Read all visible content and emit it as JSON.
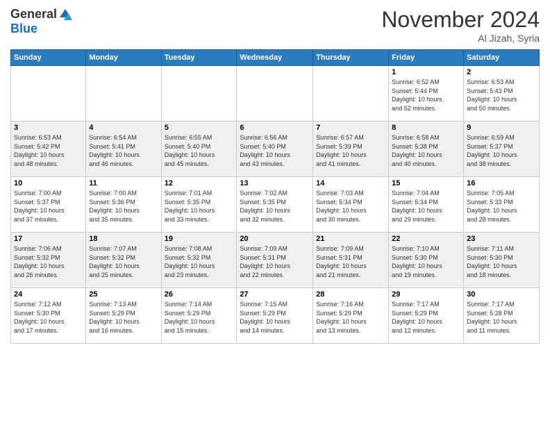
{
  "header": {
    "logo_general": "General",
    "logo_blue": "Blue",
    "month_title": "November 2024",
    "location": "Al Jizah, Syria"
  },
  "days_of_week": [
    "Sunday",
    "Monday",
    "Tuesday",
    "Wednesday",
    "Thursday",
    "Friday",
    "Saturday"
  ],
  "weeks": [
    [
      {
        "day": "",
        "info": ""
      },
      {
        "day": "",
        "info": ""
      },
      {
        "day": "",
        "info": ""
      },
      {
        "day": "",
        "info": ""
      },
      {
        "day": "",
        "info": ""
      },
      {
        "day": "1",
        "info": "Sunrise: 6:52 AM\nSunset: 5:44 PM\nDaylight: 10 hours\nand 52 minutes."
      },
      {
        "day": "2",
        "info": "Sunrise: 6:53 AM\nSunset: 5:43 PM\nDaylight: 10 hours\nand 50 minutes."
      }
    ],
    [
      {
        "day": "3",
        "info": "Sunrise: 6:53 AM\nSunset: 5:42 PM\nDaylight: 10 hours\nand 48 minutes."
      },
      {
        "day": "4",
        "info": "Sunrise: 6:54 AM\nSunset: 5:41 PM\nDaylight: 10 hours\nand 46 minutes."
      },
      {
        "day": "5",
        "info": "Sunrise: 6:55 AM\nSunset: 5:40 PM\nDaylight: 10 hours\nand 45 minutes."
      },
      {
        "day": "6",
        "info": "Sunrise: 6:56 AM\nSunset: 5:40 PM\nDaylight: 10 hours\nand 43 minutes."
      },
      {
        "day": "7",
        "info": "Sunrise: 6:57 AM\nSunset: 5:39 PM\nDaylight: 10 hours\nand 41 minutes."
      },
      {
        "day": "8",
        "info": "Sunrise: 6:58 AM\nSunset: 5:38 PM\nDaylight: 10 hours\nand 40 minutes."
      },
      {
        "day": "9",
        "info": "Sunrise: 6:59 AM\nSunset: 5:37 PM\nDaylight: 10 hours\nand 38 minutes."
      }
    ],
    [
      {
        "day": "10",
        "info": "Sunrise: 7:00 AM\nSunset: 5:37 PM\nDaylight: 10 hours\nand 37 minutes."
      },
      {
        "day": "11",
        "info": "Sunrise: 7:00 AM\nSunset: 5:36 PM\nDaylight: 10 hours\nand 35 minutes."
      },
      {
        "day": "12",
        "info": "Sunrise: 7:01 AM\nSunset: 5:35 PM\nDaylight: 10 hours\nand 33 minutes."
      },
      {
        "day": "13",
        "info": "Sunrise: 7:02 AM\nSunset: 5:35 PM\nDaylight: 10 hours\nand 32 minutes."
      },
      {
        "day": "14",
        "info": "Sunrise: 7:03 AM\nSunset: 5:34 PM\nDaylight: 10 hours\nand 30 minutes."
      },
      {
        "day": "15",
        "info": "Sunrise: 7:04 AM\nSunset: 5:34 PM\nDaylight: 10 hours\nand 29 minutes."
      },
      {
        "day": "16",
        "info": "Sunrise: 7:05 AM\nSunset: 5:33 PM\nDaylight: 10 hours\nand 28 minutes."
      }
    ],
    [
      {
        "day": "17",
        "info": "Sunrise: 7:06 AM\nSunset: 5:32 PM\nDaylight: 10 hours\nand 26 minutes."
      },
      {
        "day": "18",
        "info": "Sunrise: 7:07 AM\nSunset: 5:32 PM\nDaylight: 10 hours\nand 25 minutes."
      },
      {
        "day": "19",
        "info": "Sunrise: 7:08 AM\nSunset: 5:32 PM\nDaylight: 10 hours\nand 23 minutes."
      },
      {
        "day": "20",
        "info": "Sunrise: 7:09 AM\nSunset: 5:31 PM\nDaylight: 10 hours\nand 22 minutes."
      },
      {
        "day": "21",
        "info": "Sunrise: 7:09 AM\nSunset: 5:31 PM\nDaylight: 10 hours\nand 21 minutes."
      },
      {
        "day": "22",
        "info": "Sunrise: 7:10 AM\nSunset: 5:30 PM\nDaylight: 10 hours\nand 19 minutes."
      },
      {
        "day": "23",
        "info": "Sunrise: 7:11 AM\nSunset: 5:30 PM\nDaylight: 10 hours\nand 18 minutes."
      }
    ],
    [
      {
        "day": "24",
        "info": "Sunrise: 7:12 AM\nSunset: 5:30 PM\nDaylight: 10 hours\nand 17 minutes."
      },
      {
        "day": "25",
        "info": "Sunrise: 7:13 AM\nSunset: 5:29 PM\nDaylight: 10 hours\nand 16 minutes."
      },
      {
        "day": "26",
        "info": "Sunrise: 7:14 AM\nSunset: 5:29 PM\nDaylight: 10 hours\nand 15 minutes."
      },
      {
        "day": "27",
        "info": "Sunrise: 7:15 AM\nSunset: 5:29 PM\nDaylight: 10 hours\nand 14 minutes."
      },
      {
        "day": "28",
        "info": "Sunrise: 7:16 AM\nSunset: 5:29 PM\nDaylight: 10 hours\nand 13 minutes."
      },
      {
        "day": "29",
        "info": "Sunrise: 7:17 AM\nSunset: 5:29 PM\nDaylight: 10 hours\nand 12 minutes."
      },
      {
        "day": "30",
        "info": "Sunrise: 7:17 AM\nSunset: 5:28 PM\nDaylight: 10 hours\nand 11 minutes."
      }
    ]
  ]
}
